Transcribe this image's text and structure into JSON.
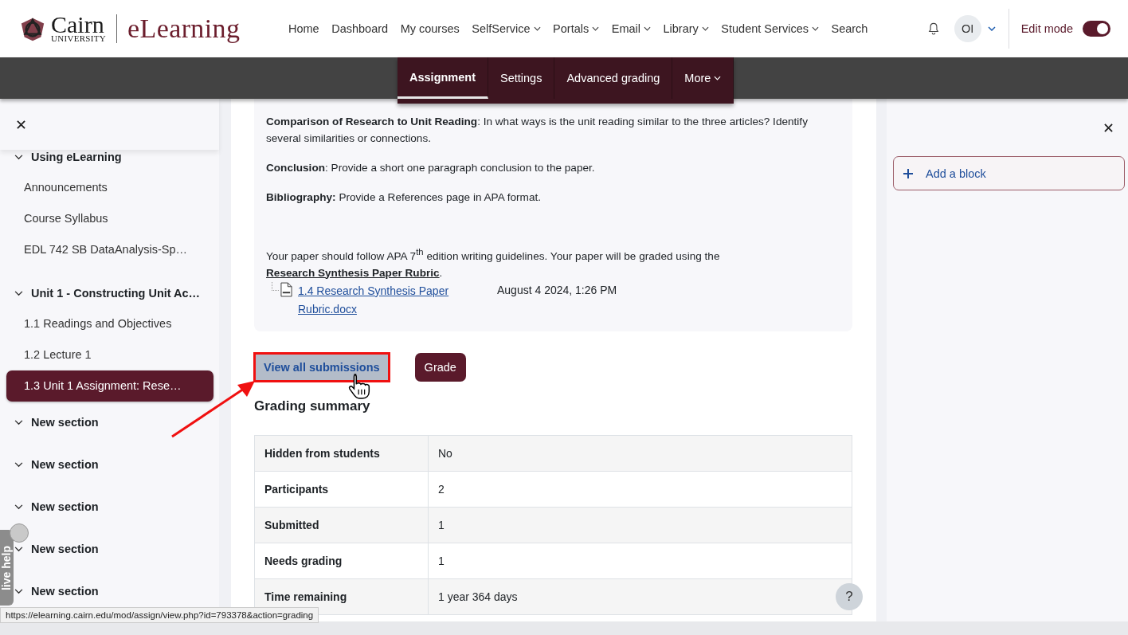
{
  "logo": {
    "name": "Cairn",
    "sub": "UNIVERSITY",
    "product": "eLearning"
  },
  "nav": [
    {
      "label": "Home",
      "has_menu": false
    },
    {
      "label": "Dashboard",
      "has_menu": false
    },
    {
      "label": "My courses",
      "has_menu": false
    },
    {
      "label": "SelfService",
      "has_menu": true
    },
    {
      "label": "Portals",
      "has_menu": true
    },
    {
      "label": "Email",
      "has_menu": true
    },
    {
      "label": "Library",
      "has_menu": true
    },
    {
      "label": "Student Services",
      "has_menu": true
    },
    {
      "label": "Search",
      "has_menu": false
    }
  ],
  "user": {
    "initials": "OI"
  },
  "edit_mode": {
    "label": "Edit mode",
    "on": true
  },
  "tabs": [
    {
      "label": "Assignment",
      "selected": true,
      "has_menu": false
    },
    {
      "label": "Settings",
      "selected": false,
      "has_menu": false
    },
    {
      "label": "Advanced grading",
      "selected": false,
      "has_menu": false
    },
    {
      "label": "More",
      "selected": false,
      "has_menu": true
    }
  ],
  "sidebar": {
    "sections": [
      {
        "title": "Using eLearning",
        "expanded": true,
        "items": [
          {
            "label": "Announcements",
            "selected": false
          },
          {
            "label": "Course Syllabus",
            "selected": false
          },
          {
            "label": "EDL 742 SB DataAnalysis-Sp…",
            "selected": false
          }
        ]
      },
      {
        "title": "Unit 1 - Constructing Unit Ac…",
        "expanded": true,
        "items": [
          {
            "label": "1.1 Readings and Objectives",
            "selected": false
          },
          {
            "label": "1.2 Lecture 1",
            "selected": false
          },
          {
            "label": "1.3 Unit 1 Assignment: Rese…",
            "selected": true
          }
        ]
      },
      {
        "title": "New section",
        "expanded": true
      },
      {
        "title": "New section",
        "expanded": true
      },
      {
        "title": "New section",
        "expanded": true
      },
      {
        "title": "New section",
        "expanded": true
      },
      {
        "title": "New section",
        "expanded": true
      }
    ]
  },
  "description": {
    "paragraphs": [
      "**Comparison of Research to Unit Reading**: In what ways is the unit reading similar to the three articles? Identify several similarities or connections.",
      "**Conclusion**: Provide a short one paragraph conclusion to the paper.",
      "**Bibliography:** Provide a References page in APA format."
    ],
    "closing": {
      "text": "Your paper should follow APA 7$^{th}$ edition writing guidelines. Your paper will be graded using the ",
      "link": "Research Synthesis Paper Rubric",
      "after": "."
    },
    "attachment": {
      "name": "1.4 Research Synthesis Paper Rubric.docx",
      "date": "August 4 2024, 1:26 PM"
    }
  },
  "actions": [
    {
      "label": "View all submissions",
      "kind": "secondary",
      "highlighted": true
    },
    {
      "label": "Grade",
      "kind": "primary",
      "highlighted": false
    }
  ],
  "grading_summary": {
    "title": "Grading summary",
    "rows": [
      [
        "Hidden from students",
        "No"
      ],
      [
        "Participants",
        "2"
      ],
      [
        "Submitted",
        "1"
      ],
      [
        "Needs grading",
        "1"
      ],
      [
        "Time remaining",
        "1 year 364 days"
      ]
    ]
  },
  "blocks": {
    "add_label": "Add a block"
  },
  "live_help": {
    "label": "live help"
  },
  "help": {
    "label": "?"
  },
  "status_url": "https://elearning.cairn.edu/mod/assign/view.php?id=793378&action=grading"
}
